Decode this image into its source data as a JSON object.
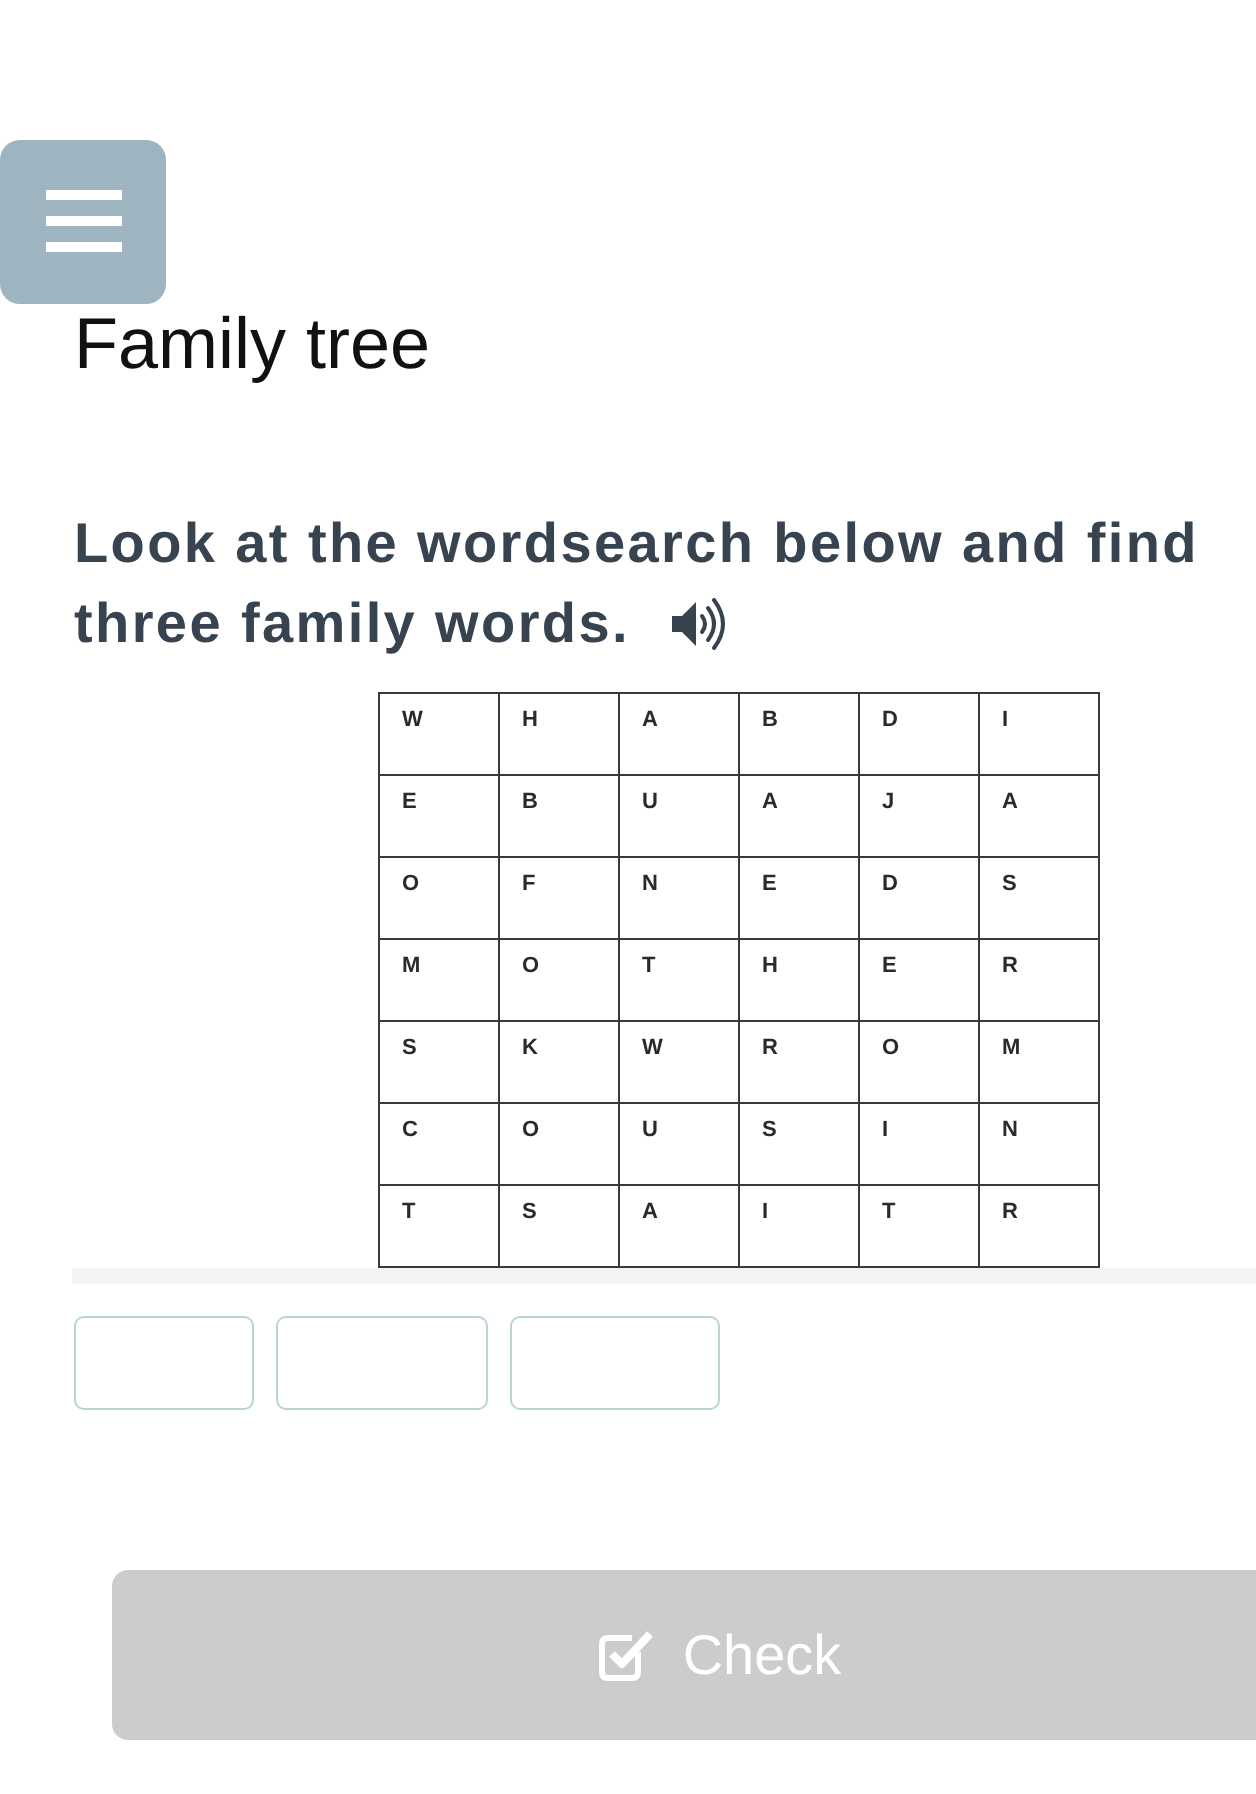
{
  "title": "Family tree",
  "instruction_lines": [
    "Look at the wordsearch below and find",
    "three family words."
  ],
  "wordsearch": {
    "rows": [
      [
        "W",
        "H",
        "A",
        "B",
        "D",
        "I"
      ],
      [
        "E",
        "B",
        "U",
        "A",
        "J",
        "A"
      ],
      [
        "O",
        "F",
        "N",
        "E",
        "D",
        "S"
      ],
      [
        "M",
        "O",
        "T",
        "H",
        "E",
        "R"
      ],
      [
        "S",
        "K",
        "W",
        "R",
        "O",
        "M"
      ],
      [
        "C",
        "O",
        "U",
        "S",
        "I",
        "N"
      ],
      [
        "T",
        "S",
        "A",
        "I",
        "T",
        "R"
      ]
    ]
  },
  "check_button": {
    "label": "Check",
    "disabled": true
  }
}
